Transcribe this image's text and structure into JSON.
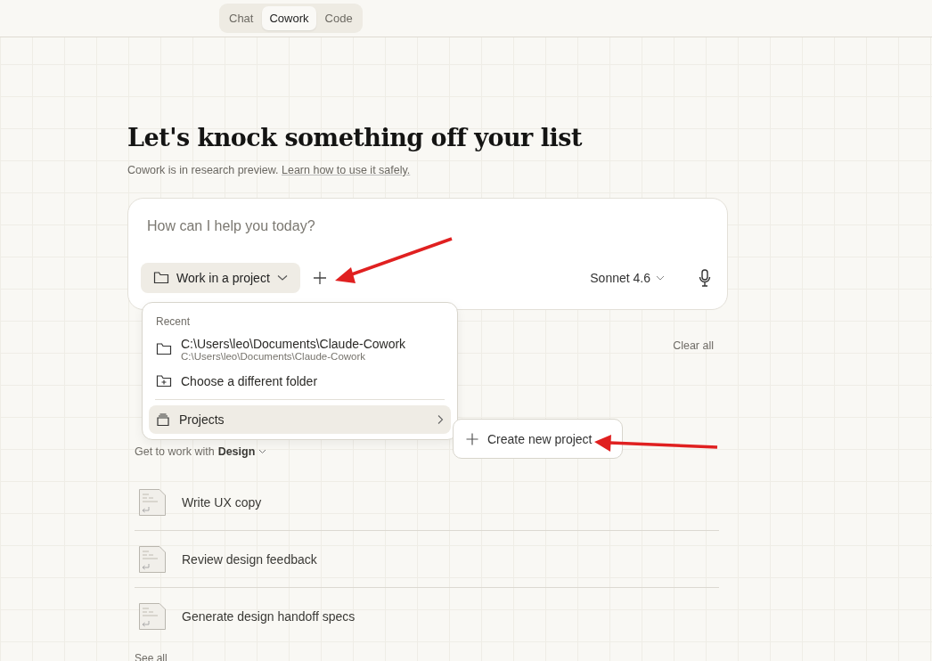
{
  "mode_tabs": [
    {
      "label": "Chat",
      "selected": false
    },
    {
      "label": "Cowork",
      "selected": true
    },
    {
      "label": "Code",
      "selected": false
    }
  ],
  "heading": "Let's knock something off your list",
  "notice": {
    "text": "Cowork is in research preview.",
    "link": "Learn how to use it safely."
  },
  "composer": {
    "placeholder": "How can I help you today?",
    "project_button": "Work in a project",
    "model": "Sonnet 4.6"
  },
  "project_menu": {
    "section": "Recent",
    "recent": [
      {
        "title": "C:\\Users\\leo\\Documents\\Claude-Cowork",
        "path": "C:\\Users\\leo\\Documents\\Claude-Cowork"
      }
    ],
    "choose_folder": "Choose a different folder",
    "projects": {
      "label": "Projects",
      "selected": true
    },
    "submenu": [
      "Create new project"
    ]
  },
  "clear_all": "Clear all",
  "work_with": {
    "prefix": "Get to work with",
    "topic": "Design"
  },
  "suggestions": [
    {
      "label": "Write UX copy"
    },
    {
      "label": "Review design feedback"
    },
    {
      "label": "Generate design handoff specs"
    }
  ],
  "see_all": "See all"
}
